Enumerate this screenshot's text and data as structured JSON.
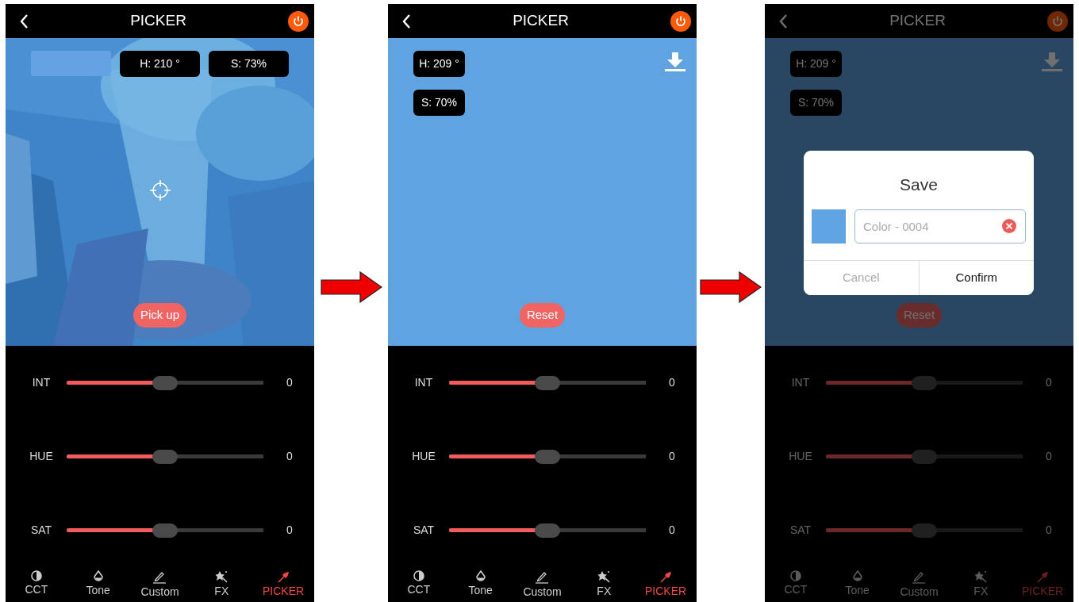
{
  "screens": [
    {
      "title": "PICKER",
      "dimmed": false,
      "chips": [
        "H: 210 °",
        "S: 73%"
      ],
      "action": "Pick up",
      "sliders": [
        {
          "label": "INT",
          "level": 0.5,
          "reading": "0"
        },
        {
          "label": "HUE",
          "level": 0.5,
          "reading": "0"
        },
        {
          "label": "SAT",
          "level": 0.5,
          "reading": "0"
        }
      ],
      "tabs": [
        {
          "kind": "cct",
          "label": "CCT",
          "selected": false
        },
        {
          "kind": "tone",
          "label": "Tone",
          "selected": false
        },
        {
          "kind": "custom",
          "label": "Custom",
          "selected": false
        },
        {
          "kind": "fx",
          "label": "FX",
          "selected": false
        },
        {
          "kind": "picker",
          "label": "PICKER",
          "selected": true
        }
      ]
    },
    {
      "title": "PICKER",
      "kind": "flat",
      "dimmed": false,
      "chips": [
        "H: 209 °",
        "S: 70%"
      ],
      "action": "Reset",
      "sliders": [
        {
          "label": "INT",
          "level": 0.5,
          "reading": "0"
        },
        {
          "label": "HUE",
          "level": 0.5,
          "reading": "0"
        },
        {
          "label": "SAT",
          "level": 0.5,
          "reading": "0"
        }
      ],
      "tabs": [
        {
          "kind": "cct",
          "label": "CCT",
          "selected": false
        },
        {
          "kind": "tone",
          "label": "Tone",
          "selected": false
        },
        {
          "kind": "custom",
          "label": "Custom",
          "selected": false
        },
        {
          "kind": "fx",
          "label": "FX",
          "selected": false
        },
        {
          "kind": "picker",
          "label": "PICKER",
          "selected": true
        }
      ]
    },
    {
      "title": "PICKER",
      "kind": "flat",
      "dimmed": true,
      "chips": [
        "H: 209 °",
        "S: 70%"
      ],
      "action": "Reset",
      "sliders": [
        {
          "label": "INT",
          "level": 0.5,
          "reading": "0"
        },
        {
          "label": "HUE",
          "level": 0.5,
          "reading": "0"
        },
        {
          "label": "SAT",
          "level": 0.5,
          "reading": "0"
        }
      ],
      "tabs": [
        {
          "kind": "cct",
          "label": "CCT",
          "selected": false
        },
        {
          "kind": "tone",
          "label": "Tone",
          "selected": false
        },
        {
          "kind": "custom",
          "label": "Custom",
          "selected": false
        },
        {
          "kind": "fx",
          "label": "FX",
          "selected": false
        },
        {
          "kind": "picker",
          "label": "PICKER",
          "selected": true
        }
      ],
      "dialog": {
        "title": "Save",
        "placeholder": "Color - 0004",
        "buttons": [
          {
            "kind": "cancel",
            "label": "Cancel"
          },
          {
            "kind": "confirm",
            "label": "Confirm"
          }
        ]
      }
    }
  ]
}
